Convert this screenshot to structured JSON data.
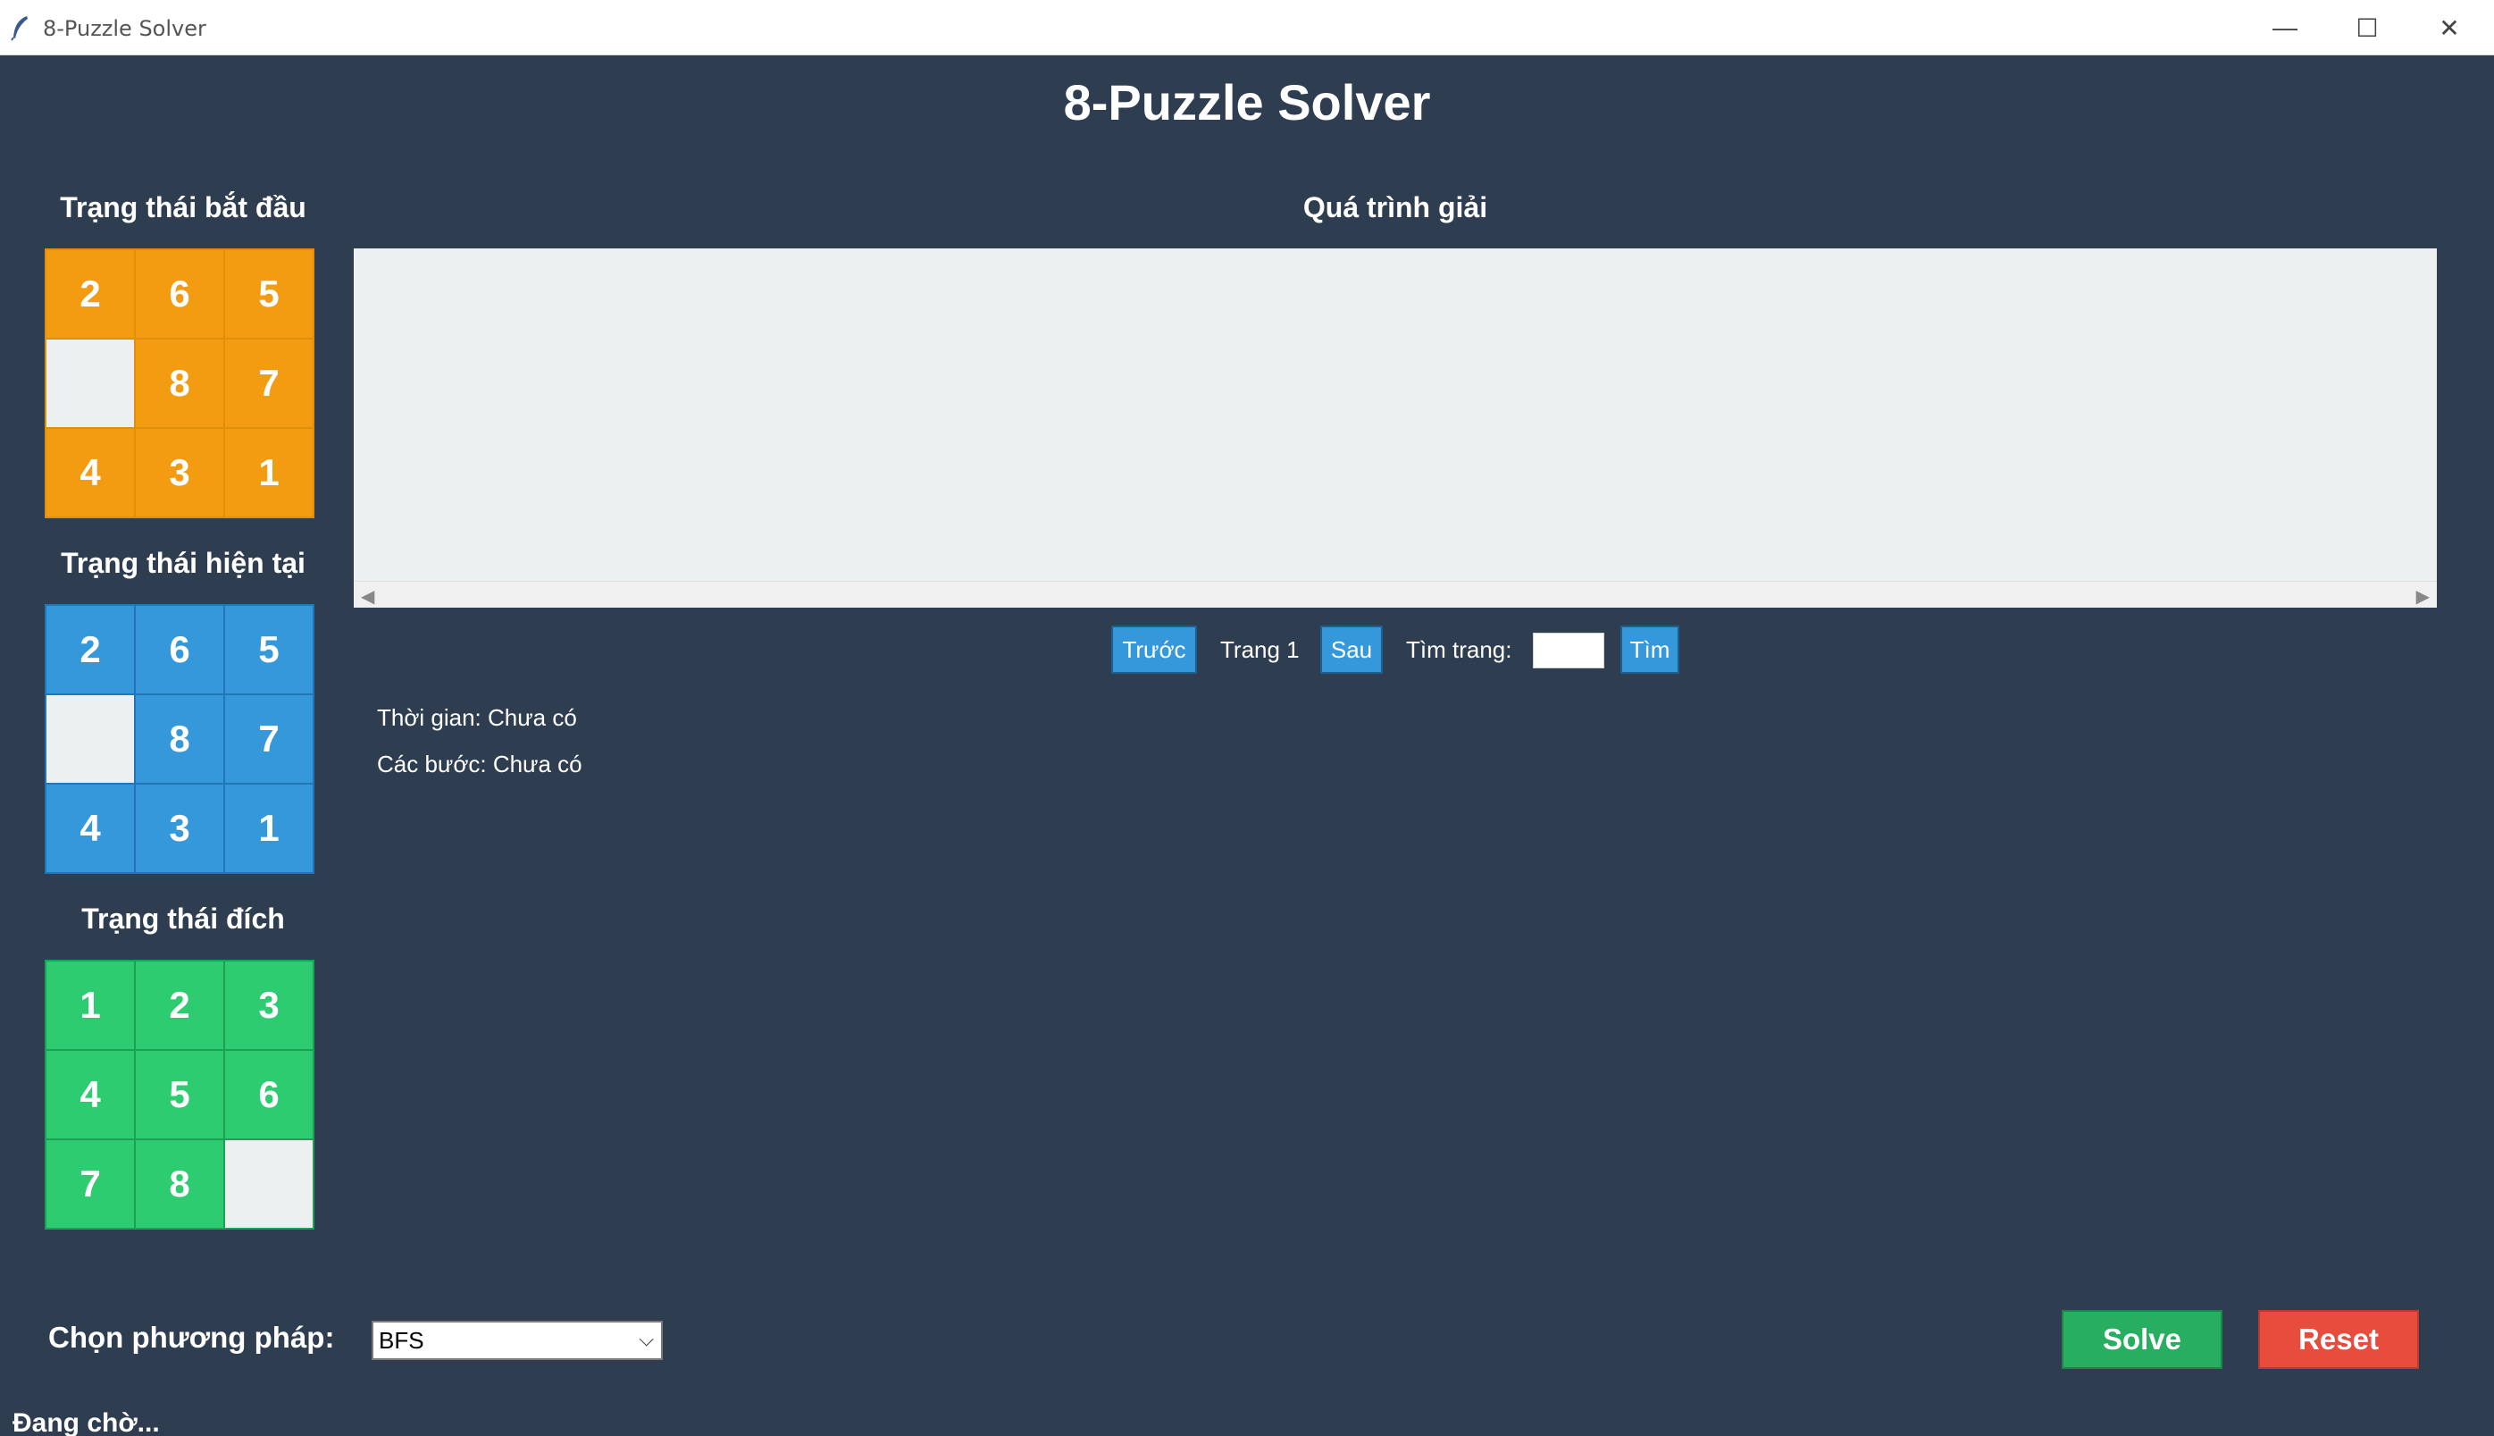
{
  "window": {
    "title": "8-Puzzle Solver",
    "minimize": "—",
    "maximize": "☐",
    "close": "✕"
  },
  "app": {
    "title": "8-Puzzle Solver"
  },
  "start_state": {
    "label": "Trạng thái bắt đầu",
    "tiles": [
      "2",
      "6",
      "5",
      "",
      "8",
      "7",
      "4",
      "3",
      "1"
    ]
  },
  "current_state": {
    "label": "Trạng thái hiện tại",
    "tiles": [
      "2",
      "6",
      "5",
      "",
      "8",
      "7",
      "4",
      "3",
      "1"
    ]
  },
  "goal_state": {
    "label": "Trạng thái đích",
    "tiles": [
      "1",
      "2",
      "3",
      "4",
      "5",
      "6",
      "7",
      "8",
      ""
    ]
  },
  "process": {
    "label": "Quá trình giải"
  },
  "pagination": {
    "prev_label": "Trước",
    "page_label": "Trang 1",
    "next_label": "Sau",
    "find_label": "Tìm trang:",
    "find_value": "",
    "search_label": "Tìm"
  },
  "info": {
    "time": "Thời gian: Chưa có",
    "steps": "Các bước: Chưa có"
  },
  "method": {
    "label": "Chọn phương pháp:",
    "selected": "BFS"
  },
  "actions": {
    "solve_label": "Solve",
    "reset_label": "Reset"
  },
  "status": {
    "text": "Đang chờ..."
  },
  "colors": {
    "background": "#2e3e50",
    "start_tile": "#f39c12",
    "current_tile": "#3498db",
    "goal_tile": "#2ecc71",
    "empty_tile": "#ecf0f1",
    "solve": "#27ae60",
    "reset": "#e74c3c"
  },
  "icons": {
    "app": "feather-icon",
    "scroll_left": "triangle-left-icon",
    "scroll_right": "triangle-right-icon",
    "dropdown": "chevron-down-icon"
  }
}
